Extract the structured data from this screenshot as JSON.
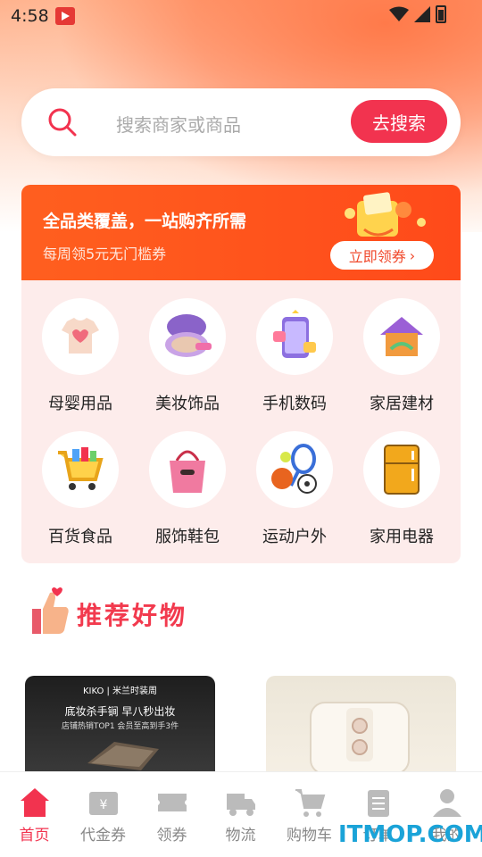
{
  "status_bar": {
    "time": "4:58"
  },
  "search": {
    "placeholder": "搜索商家或商品",
    "button_label": "去搜索"
  },
  "promo": {
    "title": "全品类覆盖，一站购齐所需",
    "subtitle": "每周领5元无门槛券",
    "button_label": "立即领券",
    "button_arrow": "›"
  },
  "categories": [
    {
      "label": "母婴用品",
      "icon": "baby-clothes-icon"
    },
    {
      "label": "美妆饰品",
      "icon": "compact-powder-icon"
    },
    {
      "label": "手机数码",
      "icon": "phone-apps-icon"
    },
    {
      "label": "家居建材",
      "icon": "house-icon"
    },
    {
      "label": "百货食品",
      "icon": "shopping-cart-icon"
    },
    {
      "label": "服饰鞋包",
      "icon": "handbag-icon"
    },
    {
      "label": "运动户外",
      "icon": "sports-balls-icon"
    },
    {
      "label": "家用电器",
      "icon": "refrigerator-icon"
    }
  ],
  "recommend": {
    "title": "推荐好物"
  },
  "products": [
    {
      "line1": "KIKO | 米兰时装周",
      "line2": "底妆杀手锏 早八秒出妆",
      "line3": "店铺热销TOP1 会员至高到手3件"
    },
    {
      "image": "air-fryer"
    }
  ],
  "tabs": [
    {
      "label": "首页",
      "icon": "home-icon",
      "active": true
    },
    {
      "label": "代金券",
      "icon": "voucher-icon"
    },
    {
      "label": "领券",
      "icon": "coupon-icon"
    },
    {
      "label": "物流",
      "icon": "truck-icon"
    },
    {
      "label": "购物车",
      "icon": "cart-icon"
    },
    {
      "label": "订单",
      "icon": "order-icon"
    },
    {
      "label": "我的",
      "icon": "user-icon"
    }
  ],
  "watermark": "ITMOP.COM",
  "colors": {
    "accent": "#f2334f",
    "promo": "#ff5f1f",
    "category_bg": "#fdeceb"
  }
}
